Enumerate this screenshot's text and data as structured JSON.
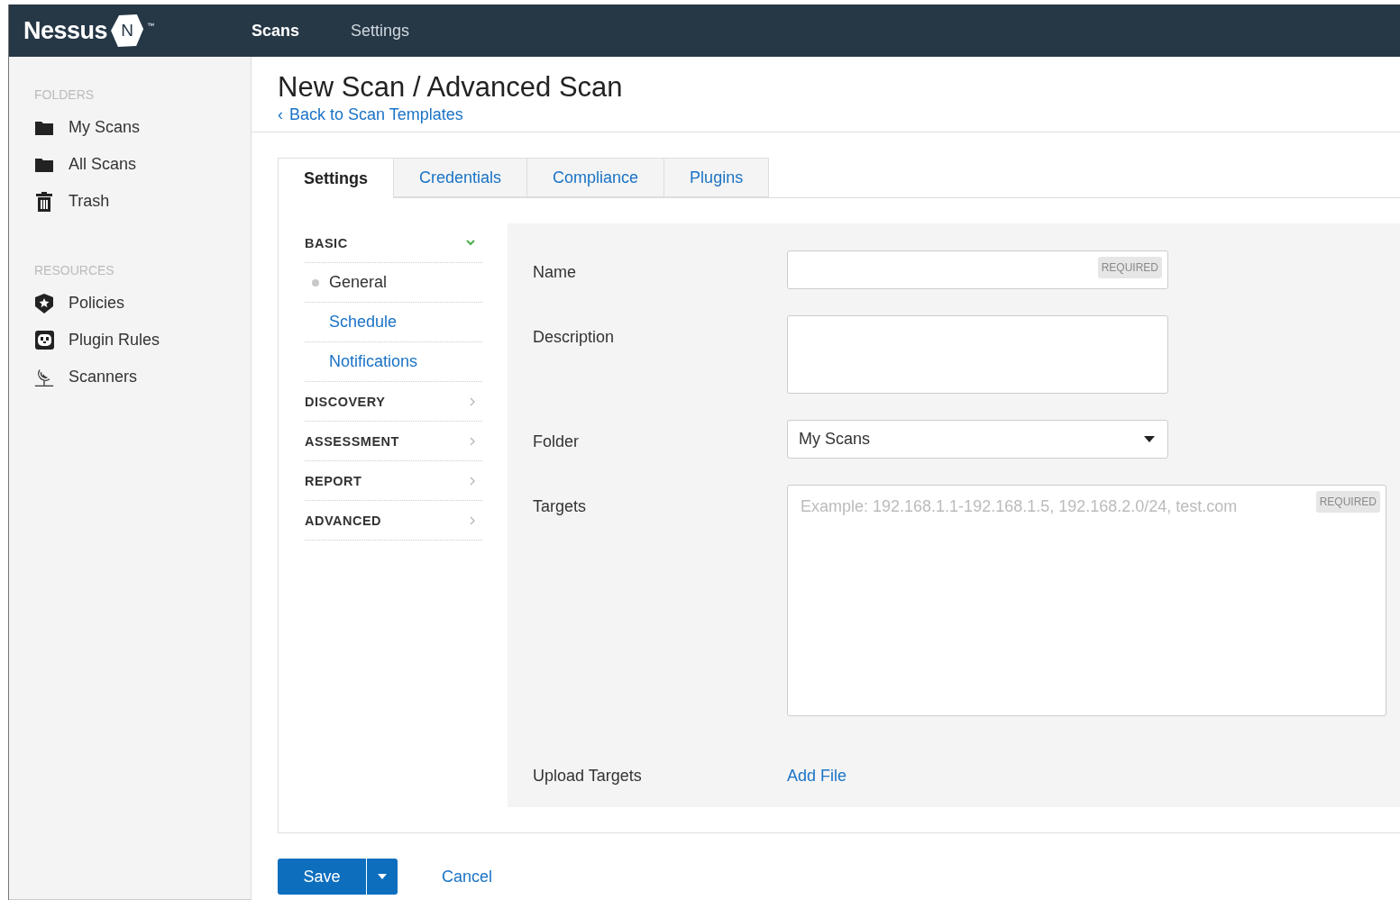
{
  "header": {
    "logo": "Nessus",
    "logo_badge": "N",
    "logo_mark": "™",
    "nav": [
      {
        "label": "Scans",
        "selected": true
      },
      {
        "label": "Settings",
        "selected": false
      }
    ]
  },
  "sidebar": {
    "sections": [
      {
        "title": "FOLDERS",
        "items": [
          {
            "label": "My Scans"
          },
          {
            "label": "All Scans"
          },
          {
            "label": "Trash"
          }
        ]
      },
      {
        "title": "RESOURCES",
        "items": [
          {
            "label": "Policies"
          },
          {
            "label": "Plugin Rules"
          },
          {
            "label": "Scanners"
          }
        ]
      }
    ]
  },
  "page": {
    "title": "New Scan / Advanced Scan",
    "back_icon": "‹",
    "back_link": "Back to Scan Templates"
  },
  "tabs": [
    {
      "label": "Settings",
      "selected": true
    },
    {
      "label": "Credentials",
      "selected": false
    },
    {
      "label": "Compliance",
      "selected": false
    },
    {
      "label": "Plugins",
      "selected": false
    }
  ],
  "settings_menu": [
    {
      "label": "BASIC",
      "expanded": true,
      "children": [
        {
          "label": "General",
          "selected": true
        },
        {
          "label": "Schedule",
          "selected": false
        },
        {
          "label": "Notifications",
          "selected": false
        }
      ]
    },
    {
      "label": "DISCOVERY",
      "expanded": false
    },
    {
      "label": "ASSESSMENT",
      "expanded": false
    },
    {
      "label": "REPORT",
      "expanded": false
    },
    {
      "label": "ADVANCED",
      "expanded": false
    }
  ],
  "form": [
    {
      "kind": "text",
      "label": "Name",
      "badge": "REQUIRED"
    },
    {
      "kind": "textarea",
      "label": "Description"
    },
    {
      "kind": "select",
      "label": "Folder",
      "value": "My Scans"
    },
    {
      "kind": "targets",
      "label": "Targets",
      "placeholder": "Example: 192.168.1.1-192.168.1.5, 192.168.2.0/24, test.com",
      "badge": "REQUIRED"
    },
    {
      "kind": "link",
      "label": "Upload Targets",
      "link": "Add File"
    }
  ],
  "actions": {
    "save": "Save",
    "cancel": "Cancel"
  }
}
